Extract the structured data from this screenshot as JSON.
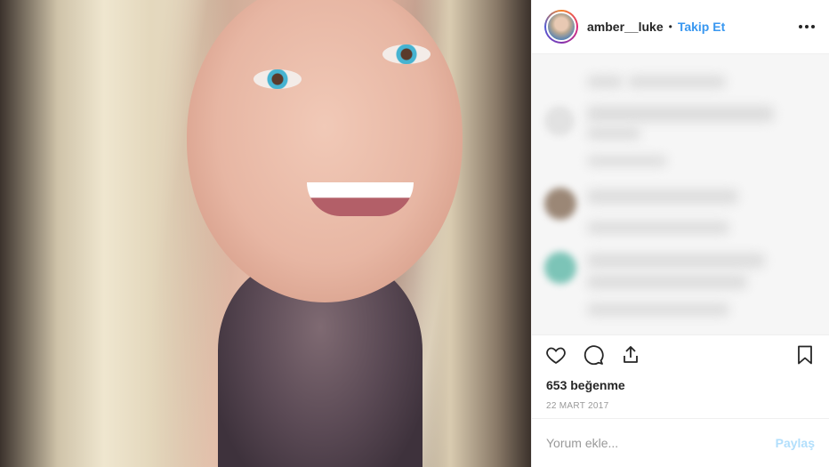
{
  "header": {
    "username": "amber__luke",
    "separator": "•",
    "follow_label": "Takip Et",
    "more_icon": "more-horizontal-icon"
  },
  "actions": {
    "like_icon": "heart-icon",
    "comment_icon": "comment-bubble-icon",
    "share_icon": "share-upload-icon",
    "save_icon": "bookmark-icon"
  },
  "likes_text": "653 beğenme",
  "date_text": "22 MART 2017",
  "comment_input": {
    "placeholder": "Yorum ekle...",
    "value": ""
  },
  "post_button_label": "Paylaş",
  "colors": {
    "accent_blue": "#3897f0",
    "post_disabled": "#b2dffc",
    "text": "#262626",
    "muted": "#999999"
  }
}
